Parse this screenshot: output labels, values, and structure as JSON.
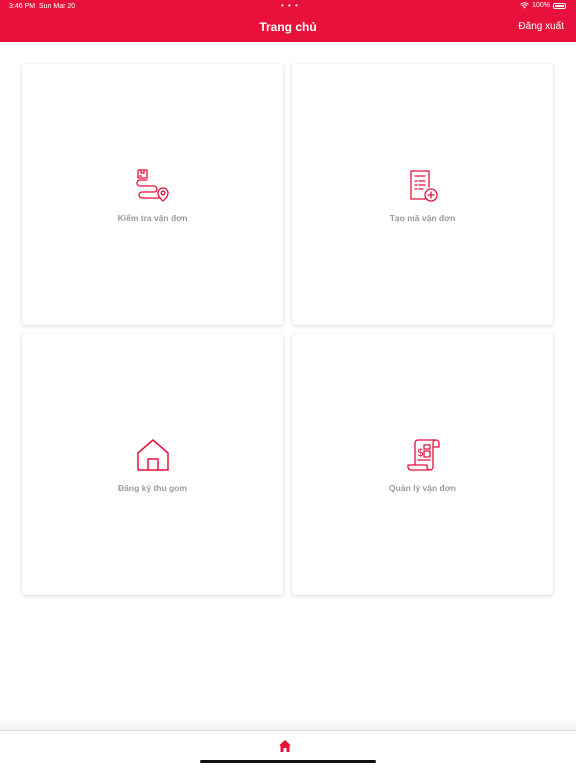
{
  "status_bar": {
    "time": "3:46 PM",
    "date": "Sun Mar 20",
    "dots": "• • •",
    "battery_percent": "100%"
  },
  "header": {
    "title": "Trang chủ",
    "logout_label": "Đăng xuất",
    "color": "#e8113c"
  },
  "cards": [
    {
      "label": "Kiểm tra vận đơn",
      "icon": "route-tracking-icon"
    },
    {
      "label": "Tạo mã vận đơn",
      "icon": "create-document-icon"
    },
    {
      "label": "Đăng ký thu gom",
      "icon": "home-pickup-icon"
    },
    {
      "label": "Quản lý vận đơn",
      "icon": "receipt-manage-icon"
    }
  ],
  "tabbar": {
    "active_tab": "home-icon"
  }
}
